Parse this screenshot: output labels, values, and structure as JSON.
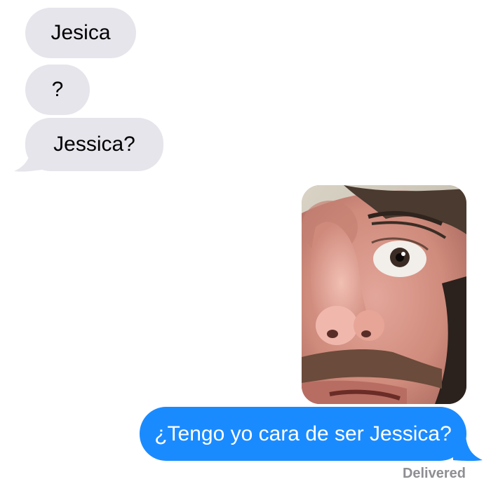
{
  "conversation": {
    "incoming": [
      {
        "text": "Jesica"
      },
      {
        "text": "?"
      },
      {
        "text": "Jessica?"
      }
    ],
    "outgoing": {
      "photo": {
        "icon": "photo-face-closeup"
      },
      "text": "¿Tengo yo cara de ser Jessica?",
      "status": "Delivered"
    }
  },
  "colors": {
    "incoming_bubble": "#e6e5eb",
    "outgoing_bubble": "#1a8bff",
    "status_text": "#8e8e93"
  }
}
